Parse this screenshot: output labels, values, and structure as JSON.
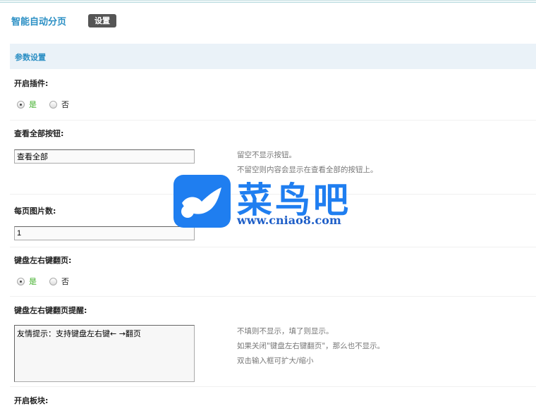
{
  "header": {
    "title": "智能自动分页",
    "settings_badge": "设置"
  },
  "section": {
    "title": "参数设置"
  },
  "fields": {
    "enable_plugin": {
      "label": "开启插件:",
      "yes": "是",
      "no": "否",
      "selected": "yes"
    },
    "view_all_button": {
      "label": "查看全部按钮:",
      "value": "查看全部",
      "help": [
        "留空不显示按钮。",
        "不留空则内容会显示在查看全部的按钮上。"
      ]
    },
    "images_per_page": {
      "label": "每页图片数:",
      "value": "1"
    },
    "keyboard_paging": {
      "label": "键盘左右键翻页:",
      "yes": "是",
      "no": "否",
      "selected": "yes"
    },
    "keyboard_tip": {
      "label": "键盘左右键翻页提醒:",
      "value": "友情提示：支持键盘左右键← →翻页",
      "help": [
        "不填则不显示，填了则显示。",
        "如果关闭\"键盘左右键翻页\"，那么也不显示。",
        "双击输入框可扩大/缩小"
      ]
    },
    "enable_block": {
      "label": "开启板块:"
    }
  },
  "watermark": {
    "name": "菜鸟吧",
    "url": "www.cniao8.com"
  },
  "colors": {
    "accent": "#2b8fc4",
    "yes_green": "#3fae29",
    "band": "#eaf2f8"
  }
}
